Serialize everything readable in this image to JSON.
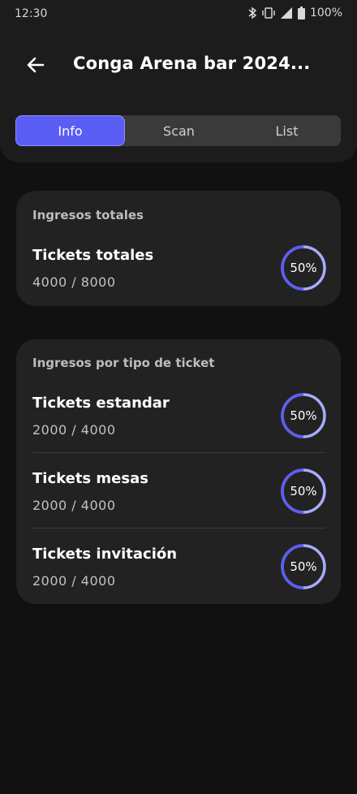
{
  "status_bar": {
    "time": "12:30",
    "battery": "100%",
    "icons": [
      "bluetooth-icon",
      "vibrate-icon",
      "signal-icon",
      "battery-icon"
    ]
  },
  "header": {
    "back_icon": "arrow-left-icon",
    "title": "Conga Arena bar 2024..."
  },
  "tabs": [
    {
      "label": "Info",
      "active": true
    },
    {
      "label": "Scan",
      "active": false
    },
    {
      "label": "List",
      "active": false
    }
  ],
  "totals_card": {
    "heading": "Ingresos totales",
    "rows": [
      {
        "title": "Tickets totales",
        "count": "4000 / 8000",
        "percent_label": "50%",
        "progress": 0.5
      }
    ]
  },
  "types_card": {
    "heading": "Ingresos por tipo de ticket",
    "rows": [
      {
        "title": "Tickets estandar",
        "count": "2000 / 4000",
        "percent_label": "50%",
        "progress": 0.5
      },
      {
        "title": "Tickets mesas",
        "count": "2000 / 4000",
        "percent_label": "50%",
        "progress": 0.5
      },
      {
        "title": "Tickets invitación",
        "count": "2000 / 4000",
        "percent_label": "50%",
        "progress": 0.5
      }
    ]
  },
  "colors": {
    "accent": "#5b5ef4",
    "ring_light": "#a9abff",
    "card": "#222222",
    "background": "#111111"
  }
}
